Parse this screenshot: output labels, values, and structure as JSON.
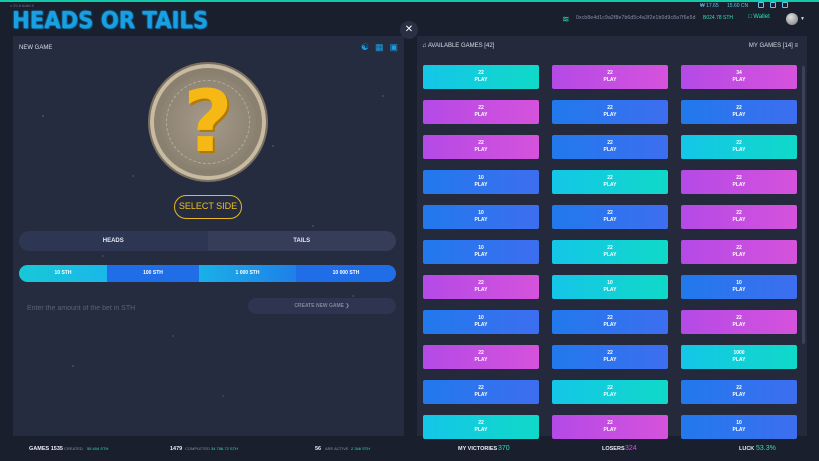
{
  "header": {
    "version": "v 25.8 build 5",
    "logo": "HEADS OR TAILS",
    "rate_usd": "₩ 17.65",
    "rate_cny": "15.60 CN",
    "wallet_address": "0xcb8e4d1c9a2f8e7b6d5c4a3f2e1b0d9c8a7f6e5d",
    "balance": "B024.78 STH",
    "wallet_label": "Wallet"
  },
  "left": {
    "title": "NEW GAME",
    "icons": [
      "chat-icon",
      "stats-icon",
      "save-icon"
    ],
    "select_side": "SELECT SIDE",
    "heads": "HEADS",
    "tails": "TAILS",
    "amounts": [
      "10 STH",
      "100 STH",
      "1 000 STH",
      "10 000 STH"
    ],
    "bet_placeholder": "Enter the amount of the bet in STH",
    "create_button": "CREATE NEW GAME ❯"
  },
  "right": {
    "available": "AVAILABLE GAMES [42]",
    "my_games": "MY GAMES [14]",
    "play_label": "PLAY",
    "cards": [
      {
        "amount": "22",
        "color": "cyan"
      },
      {
        "amount": "22",
        "color": "purple"
      },
      {
        "amount": "34",
        "color": "purple"
      },
      {
        "amount": "22",
        "color": "purple"
      },
      {
        "amount": "22",
        "color": "blue"
      },
      {
        "amount": "22",
        "color": "blue"
      },
      {
        "amount": "22",
        "color": "purple"
      },
      {
        "amount": "22",
        "color": "blue"
      },
      {
        "amount": "22",
        "color": "cyan"
      },
      {
        "amount": "10",
        "color": "blue"
      },
      {
        "amount": "22",
        "color": "cyan"
      },
      {
        "amount": "22",
        "color": "purple"
      },
      {
        "amount": "10",
        "color": "blue"
      },
      {
        "amount": "22",
        "color": "blue"
      },
      {
        "amount": "22",
        "color": "purple"
      },
      {
        "amount": "10",
        "color": "blue"
      },
      {
        "amount": "22",
        "color": "cyan"
      },
      {
        "amount": "22",
        "color": "purple"
      },
      {
        "amount": "22",
        "color": "purple"
      },
      {
        "amount": "10",
        "color": "cyan"
      },
      {
        "amount": "10",
        "color": "blue"
      },
      {
        "amount": "10",
        "color": "blue"
      },
      {
        "amount": "22",
        "color": "blue"
      },
      {
        "amount": "22",
        "color": "purple"
      },
      {
        "amount": "22",
        "color": "purple"
      },
      {
        "amount": "22",
        "color": "blue"
      },
      {
        "amount": "1000",
        "color": "cyan"
      },
      {
        "amount": "22",
        "color": "blue"
      },
      {
        "amount": "22",
        "color": "cyan"
      },
      {
        "amount": "22",
        "color": "blue"
      },
      {
        "amount": "22",
        "color": "cyan"
      },
      {
        "amount": "22",
        "color": "purple"
      },
      {
        "amount": "10",
        "color": "blue"
      }
    ]
  },
  "footer": {
    "games_label": "GAMES 1535",
    "created_label": "CREATED",
    "created_value": "55 404 STH",
    "completed_count": "1479",
    "completed_label": "COMPLETED",
    "completed_value": "34 756.72 STH",
    "active_count": "56",
    "active_label": "ARE ACTIVE",
    "active_value": "2 346 STH",
    "victories_label": "MY VICTORIES",
    "victories_value": "370",
    "losers_label": "LOSERS",
    "losers_value": "324",
    "luck_label": "LUCK",
    "luck_value": "53.3%"
  },
  "colors": {
    "cyan": "#14c6e8",
    "blue": "#2179ec",
    "purple": "#c44ee4",
    "accent_green": "#2fe0b0",
    "gold": "#f0c020"
  }
}
